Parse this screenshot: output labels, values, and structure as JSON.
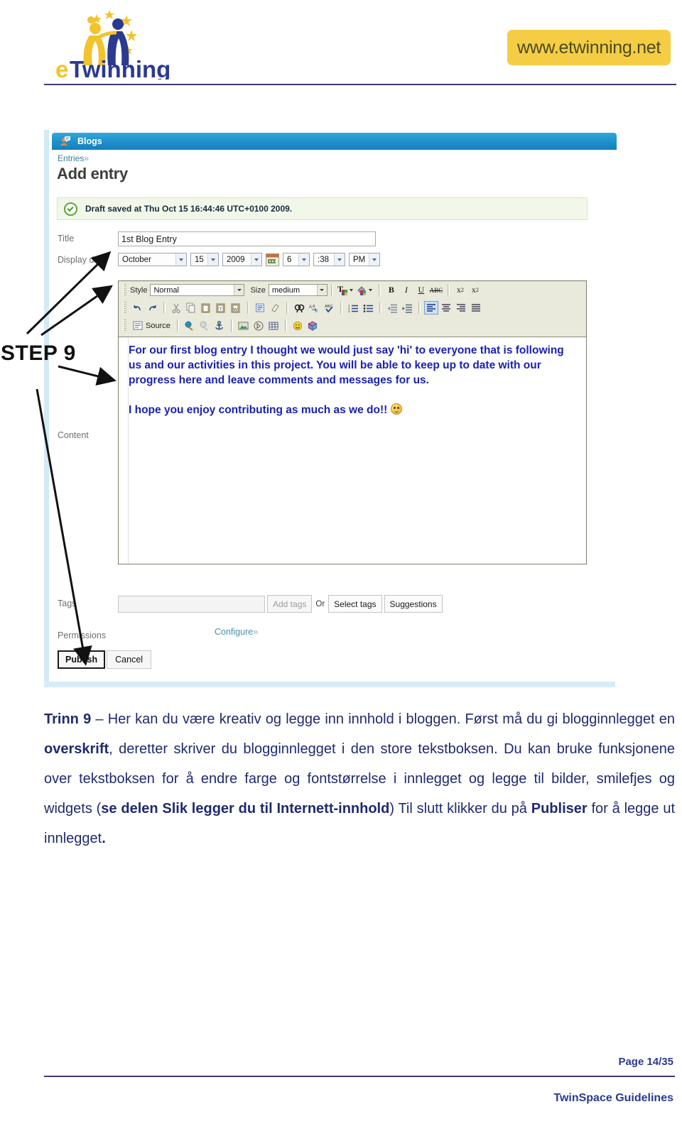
{
  "header": {
    "logo_text": "eTwinning",
    "url_badge": "www.etwinning.net"
  },
  "screenshot": {
    "app_bar": {
      "title": "Blogs",
      "icon": "blog-person-icon"
    },
    "breadcrumb": {
      "parent": "Entries",
      "chevron": "»"
    },
    "page_title": "Add entry",
    "notice": {
      "icon": "green-check-icon",
      "text": "Draft saved at Thu Oct 15 16:44:46 UTC+0100 2009."
    },
    "form": {
      "title_label": "Title",
      "title_value": "1st Blog Entry",
      "display_date_label": "Display date",
      "date": {
        "month": "October",
        "day": "15",
        "year": "2009",
        "calendar_icon": "calendar-icon",
        "hour": "6",
        "minute": ":38",
        "meridiem": "PM"
      },
      "content_label": "Content",
      "tags_label": "Tags",
      "permissions_label": "Permissions"
    },
    "editor": {
      "toolbar": {
        "style_label": "Style",
        "style_value": "Normal",
        "size_label": "Size",
        "size_value": "medium",
        "row1_icons": [
          "text-color-icon",
          "background-color-icon",
          "bold-icon",
          "italic-icon",
          "underline-icon",
          "strikethrough-icon",
          "subscript-icon",
          "superscript-icon"
        ],
        "row2_icons": [
          "undo-icon",
          "redo-icon",
          "cut-icon",
          "copy-icon",
          "paste-icon",
          "paste-text-icon",
          "paste-word-icon",
          "select-all-icon",
          "remove-format-icon",
          "find-icon",
          "replace-icon",
          "spellcheck-icon",
          "numbered-list-icon",
          "bulleted-list-icon",
          "outdent-icon",
          "indent-icon",
          "align-left-icon",
          "align-center-icon",
          "align-right-icon",
          "justify-icon"
        ],
        "row3": {
          "source_label": "Source",
          "icons": [
            "source-icon",
            "link-icon",
            "unlink-icon",
            "anchor-icon",
            "image-icon",
            "flash-icon",
            "table-icon",
            "smiley-icon",
            "widget-icon"
          ]
        },
        "active_button": "align-left-icon"
      },
      "content_paragraphs": [
        "For our first blog entry I thought we would just say 'hi' to everyone that is following us and our activities in this project. You will be able to keep up to date with our progress here and leave comments and messages for us.",
        "I hope you enjoy contributing as much as we do!!"
      ],
      "content_has_smiley": true
    },
    "tags": {
      "input_value": "",
      "add_tags_label": "Add tags",
      "or_label": "Or",
      "select_tags_label": "Select tags",
      "suggestions_label": "Suggestions"
    },
    "permissions": {
      "configure_label": "Configure",
      "chevron": "»"
    },
    "actions": {
      "publish_label": "Publish",
      "cancel_label": "Cancel"
    }
  },
  "annotation": {
    "step_label": "STEP 9",
    "arrow_count": 3
  },
  "body_copy": {
    "segments": [
      {
        "text": "Trinn 9",
        "bold": true
      },
      {
        "text": " – Her kan du være kreativ og legge inn innhold i bloggen. Først må du gi blogginnlegget en ",
        "bold": false
      },
      {
        "text": "overskrift",
        "bold": true
      },
      {
        "text": ", deretter skriver du blogginnlegget i den store tekstboksen. Du kan bruke funksjonene over tekstboksen for å endre farge og fontstørrelse i innlegget og legge til bilder, smilefjes og widgets (",
        "bold": false
      },
      {
        "text": "se delen Slik legger du til Internett-innhold",
        "bold": true
      },
      {
        "text": ") Til slutt klikker du på ",
        "bold": false
      },
      {
        "text": "Publiser",
        "bold": true
      },
      {
        "text": " for å legge ut innlegget",
        "bold": false
      },
      {
        "text": ".",
        "bold": true
      }
    ]
  },
  "footer": {
    "page_number": "Page 14/35",
    "doc_title": "TwinSpace Guidelines"
  },
  "colors": {
    "brand_blue": "#2b3a8f",
    "badge_yellow": "#f5cd44",
    "app_bar_blue": "#1e8fcb",
    "editor_text_blue": "#1a22b0",
    "notice_green_bg": "#f1f8ea"
  }
}
